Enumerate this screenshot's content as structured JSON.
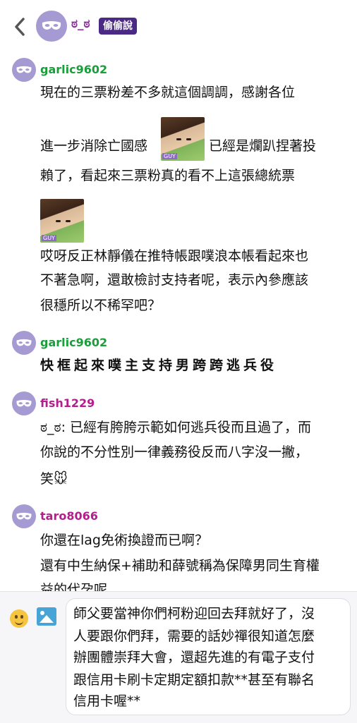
{
  "header": {
    "name": "ಠ_ಠ",
    "badge": "偷偷說"
  },
  "messages": [
    {
      "user": "garlic9602",
      "lines": [
        "現在的三票粉差不多就這個調調，感謝各位",
        "進一步消除亡國感",
        "已經是爛趴捏著投",
        "賴了，看起來三票粉真的看不上這張總統票",
        "哎呀反正林靜儀在推特帳跟噗浪本帳看起來也",
        "不著急啊，還敢檢討支持者呢，表示內參應該",
        "很穩所以不稀罕吧？"
      ],
      "sticker_tag": "GUY"
    },
    {
      "user": "garlic9602",
      "lines": [
        "快框起來噗主支持男跨跨逃兵役"
      ]
    },
    {
      "user": "fish1229",
      "lines": [
        "ಠ_ಠ: 已經有胯胯示範如何逃兵役而且過了，而",
        "你說的不分性別一律義務役反而八字沒一撇，",
        "笑🐭"
      ]
    },
    {
      "user": "taro8066",
      "lines": [
        "你還在lag免術換證而已啊？",
        "還有中生納保+補助和薛號稱為保障男同生育權",
        "益的代孕呢"
      ]
    }
  ],
  "composer": {
    "lines": [
      "師父要當神你們柯粉迎回去拜就好了，沒",
      "人要跟你們拜，需要的話妙禪很知道怎麼",
      "辦團體崇拜大會，還超先進的有電子支付",
      "跟信用卡刷卡定期定額扣款**甚至有聯名",
      "信用卡喔**"
    ]
  },
  "colors": {
    "accent": "#a59bd2",
    "badge_bg": "#4b2a86",
    "username_green": "#1a9e3a",
    "username_magenta": "#b31d8c"
  }
}
